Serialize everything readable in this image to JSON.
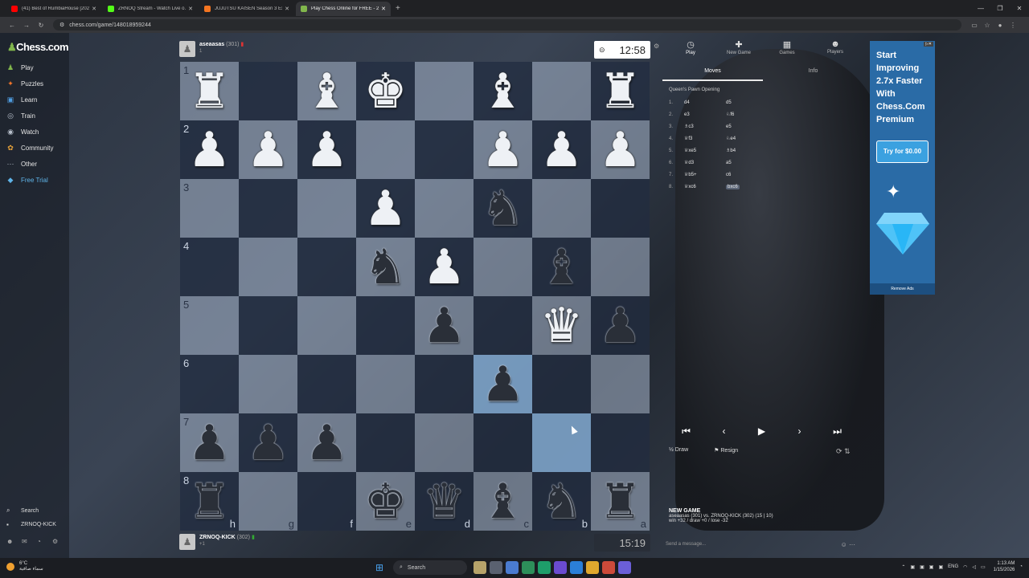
{
  "browser": {
    "tabs": [
      {
        "title": "(41) Best of RumbiaHouse [202...",
        "color": "#ff0000",
        "active": false
      },
      {
        "title": "ZRNOQ Stream - Watch Live o...",
        "color": "#53fc18",
        "active": false
      },
      {
        "title": "JUJUTSU KAISEN Season 3 Exe...",
        "color": "#f47521",
        "active": false
      },
      {
        "title": "Play Chess Online for FREE - 2 ...",
        "color": "#81b64c",
        "active": true
      }
    ],
    "url": "chess.com/game/148018959244"
  },
  "sidebar": {
    "logo": "Chess.com",
    "items": [
      {
        "label": "Play",
        "icon": "play-icon",
        "glyph": "♟",
        "color": "#81b64c"
      },
      {
        "label": "Puzzles",
        "icon": "puzzle-icon",
        "glyph": "✦",
        "color": "#f5762a"
      },
      {
        "label": "Learn",
        "icon": "learn-icon",
        "glyph": "▣",
        "color": "#4f9de0"
      },
      {
        "label": "Train",
        "icon": "train-icon",
        "glyph": "◎",
        "color": "#b8c0cc"
      },
      {
        "label": "Watch",
        "icon": "watch-icon",
        "glyph": "◉",
        "color": "#b8c0cc"
      },
      {
        "label": "Community",
        "icon": "community-icon",
        "glyph": "✿",
        "color": "#e8a33a"
      },
      {
        "label": "Other",
        "icon": "more-icon",
        "glyph": "···",
        "color": "#b8c0cc"
      },
      {
        "label": "Free Trial",
        "icon": "diamond-icon",
        "glyph": "◆",
        "color": "#5fb4e8"
      }
    ],
    "search_label": "Search",
    "user_label": "ZRNOQ-KICK"
  },
  "top_player": {
    "name": "aseaasas",
    "rating": "(301)",
    "sub": "1",
    "clock": "12:58"
  },
  "bottom_player": {
    "name": "ZRNOQ-KICK",
    "rating": "(302)",
    "sub": "+1",
    "clock": "15:19"
  },
  "board": {
    "ranks": [
      "1",
      "2",
      "3",
      "4",
      "5",
      "6",
      "7",
      "8"
    ],
    "files": [
      "h",
      "g",
      "f",
      "e",
      "d",
      "c",
      "b",
      "a"
    ],
    "rows": [
      [
        "wR",
        "",
        "wB",
        "wK",
        "",
        "wB",
        "",
        "wR"
      ],
      [
        "wP",
        "wP",
        "wP",
        "",
        "",
        "wP",
        "wP",
        "wP"
      ],
      [
        "",
        "",
        "",
        "wP",
        "",
        "bN",
        "",
        ""
      ],
      [
        "",
        "",
        "",
        "bN",
        "wP",
        "",
        "bB",
        ""
      ],
      [
        "",
        "",
        "",
        "",
        "bP",
        "",
        "wQ",
        "bP"
      ],
      [
        "",
        "",
        "",
        "",
        "",
        "bP",
        "",
        ""
      ],
      [
        "bP",
        "bP",
        "bP",
        "",
        "",
        "",
        "",
        ""
      ],
      [
        "bR",
        "",
        "",
        "bK",
        "bQ",
        "bB",
        "bN",
        "bR"
      ]
    ],
    "highlights": [
      [
        5,
        5
      ],
      [
        6,
        6
      ]
    ]
  },
  "panel": {
    "tabs": [
      {
        "label": "Play",
        "glyph": "◷"
      },
      {
        "label": "New Game",
        "glyph": "✚"
      },
      {
        "label": "Games",
        "glyph": "▦"
      },
      {
        "label": "Players",
        "glyph": "☻"
      }
    ],
    "subtabs": [
      "Moves",
      "Info"
    ],
    "opening": "Queen's Pawn Opening",
    "moves": [
      {
        "n": "1.",
        "w": "d4",
        "b": "d5"
      },
      {
        "n": "2.",
        "w": "e3",
        "b": "♘f6"
      },
      {
        "n": "3.",
        "w": "♗c3",
        "b": "e5"
      },
      {
        "n": "4.",
        "w": "♕f3",
        "b": "♘e4"
      },
      {
        "n": "5.",
        "w": "♕xe5",
        "b": "♗b4"
      },
      {
        "n": "6.",
        "w": "♕d3",
        "b": "a5"
      },
      {
        "n": "7.",
        "w": "♕b5+",
        "b": "c6"
      },
      {
        "n": "8.",
        "w": "♕xc6",
        "b": "bxc6"
      }
    ],
    "draw_label": "Draw",
    "resign_label": "Resign",
    "new_game": {
      "heading": "NEW GAME",
      "line1": "aseaasas (301) vs. ZRNOQ-KICK (302) (15 | 10)",
      "line2": "win +32 / draw +0 / lose -32"
    },
    "message_placeholder": "Send a message..."
  },
  "ad": {
    "headline": "Start Improving 2.7x Faster With Chess.Com Premium",
    "cta": "Try for $0.00",
    "remove": "Remove Ads"
  },
  "taskbar": {
    "weather_temp": "6°C",
    "weather_desc": "سماء صافية",
    "search": "Search",
    "lang": "ENG",
    "time": "1:13 AM",
    "date": "1/15/2026"
  }
}
